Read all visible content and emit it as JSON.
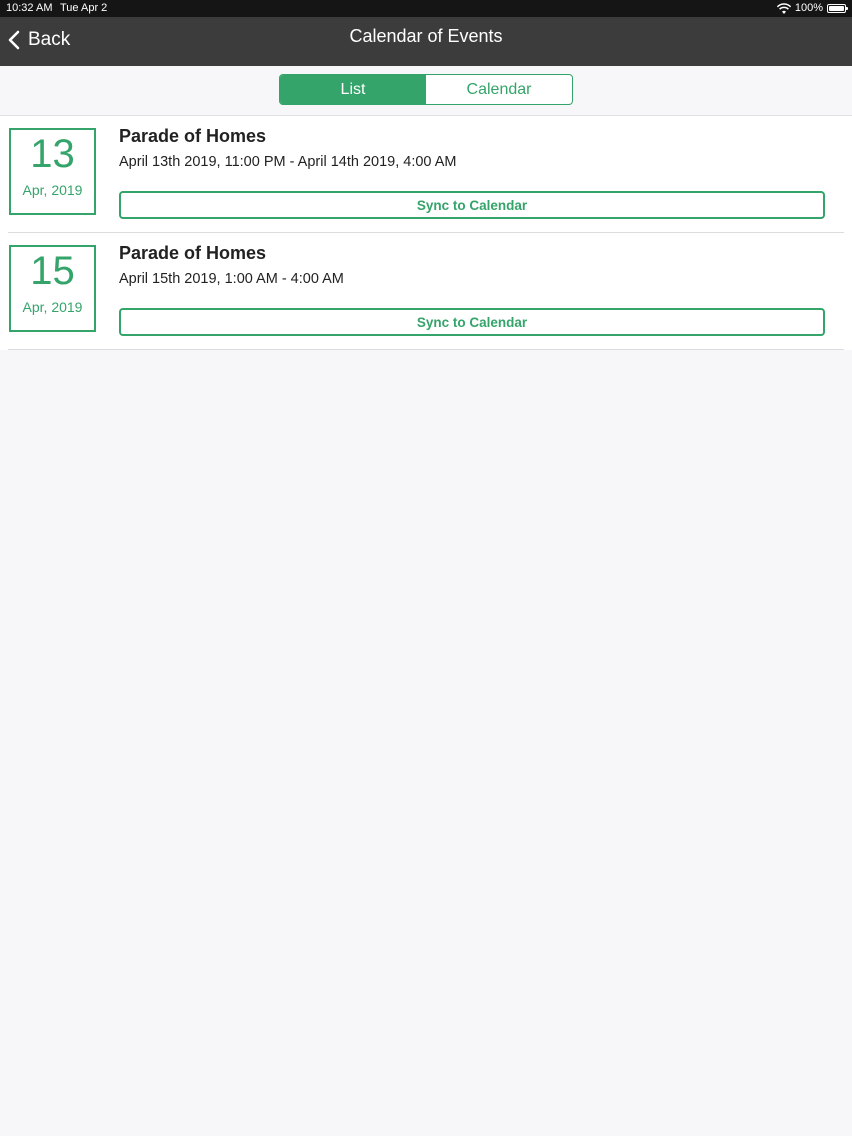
{
  "status": {
    "time": "10:32 AM",
    "date": "Tue Apr 2",
    "battery": "100%"
  },
  "nav": {
    "back_label": "Back",
    "title": "Calendar of Events"
  },
  "segments": {
    "list": "List",
    "calendar": "Calendar",
    "active": "List"
  },
  "colors": {
    "accent": "#35a46a",
    "nav_bg": "#3d3c3c"
  },
  "events": [
    {
      "day": "13",
      "month_year": "Apr, 2019",
      "title": "Parade of Homes",
      "time": "April 13th 2019, 11:00 PM - April 14th 2019, 4:00 AM",
      "sync_label": "Sync to Calendar"
    },
    {
      "day": "15",
      "month_year": "Apr, 2019",
      "title": "Parade of Homes",
      "time": "April 15th 2019, 1:00 AM - 4:00 AM",
      "sync_label": "Sync to Calendar"
    }
  ]
}
